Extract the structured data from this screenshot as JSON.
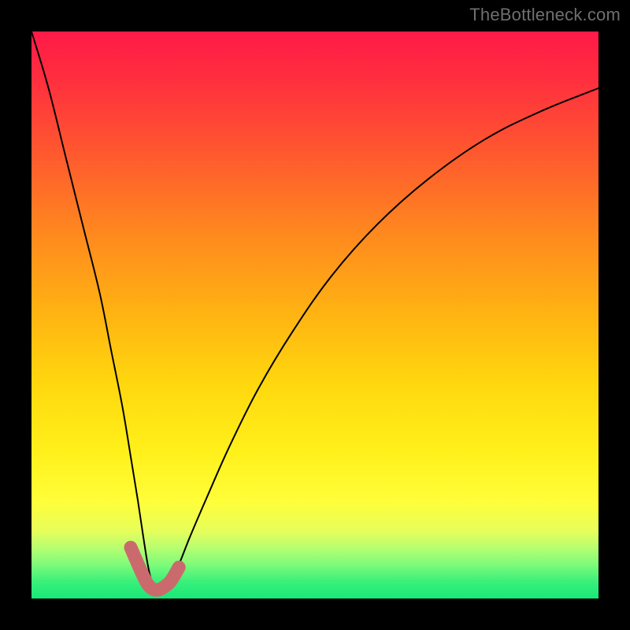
{
  "watermark": "TheBottleneck.com",
  "chart_data": {
    "type": "line",
    "title": "",
    "xlabel": "",
    "ylabel": "",
    "xlim": [
      0,
      100
    ],
    "ylim": [
      0,
      100
    ],
    "grid": false,
    "legend": false,
    "background_gradient": {
      "direction": "vertical",
      "stops": [
        {
          "pos": 0.0,
          "color": "#ff1a47"
        },
        {
          "pos": 0.5,
          "color": "#ffb412"
        },
        {
          "pos": 0.83,
          "color": "#fffe3a"
        },
        {
          "pos": 1.0,
          "color": "#18e878"
        }
      ]
    },
    "series": [
      {
        "name": "bottleneck-curve",
        "x": [
          0,
          3,
          6,
          9,
          12,
          14,
          16,
          17.5,
          18.8,
          19.7,
          20.5,
          21.2,
          22,
          23,
          24.5,
          26,
          28,
          31,
          35,
          40,
          46,
          53,
          61,
          70,
          80,
          90,
          100
        ],
        "y": [
          100,
          90,
          78,
          66,
          54,
          44,
          34,
          25,
          17,
          11,
          6,
          3,
          1,
          1,
          3,
          6,
          11,
          18,
          27,
          37,
          47,
          57,
          66,
          74,
          81,
          86,
          90
        ]
      },
      {
        "name": "optimal-range-highlight",
        "x": [
          17.5,
          18.8,
          19.7,
          20.5,
          21.2,
          22,
          23,
          24.5,
          26
        ],
        "y": [
          9,
          6,
          4,
          2.5,
          1.8,
          1.5,
          1.8,
          3,
          5.5
        ]
      }
    ],
    "annotations": []
  }
}
